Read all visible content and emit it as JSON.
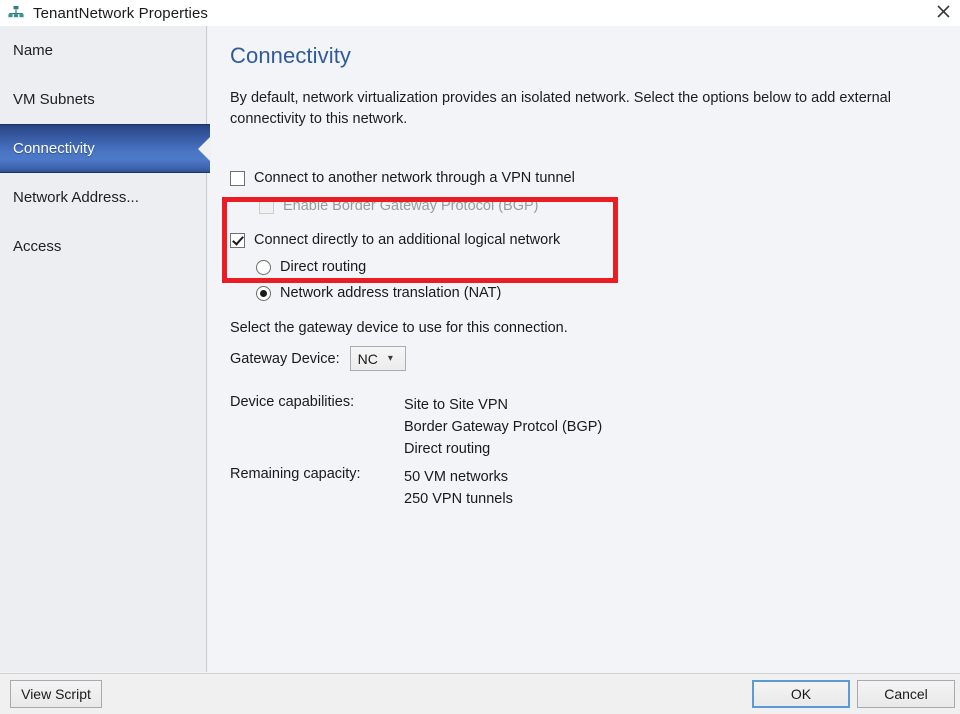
{
  "window": {
    "title": "TenantNetwork Properties",
    "title_icon": "network-properties-icon",
    "close_icon": "close-icon"
  },
  "sidebar": {
    "items": [
      {
        "label": "Name",
        "selected": false
      },
      {
        "label": "VM Subnets",
        "selected": false
      },
      {
        "label": "Connectivity",
        "selected": true
      },
      {
        "label": "Network Address...",
        "selected": false
      },
      {
        "label": "Access",
        "selected": false
      }
    ]
  },
  "content": {
    "heading": "Connectivity",
    "intro": "By default, network virtualization provides an isolated network. Select the options below to add external connectivity to this network.",
    "vpn_checkbox": {
      "label": "Connect to another network through a VPN tunnel",
      "checked": false
    },
    "bgp_checkbox": {
      "label": "Enable Border Gateway Protocol (BGP)",
      "checked": false,
      "disabled": true
    },
    "logical_network_checkbox": {
      "label": "Connect directly to an additional logical network",
      "checked": true
    },
    "routing_radios": [
      {
        "label": "Direct routing",
        "selected": false
      },
      {
        "label": "Network address translation (NAT)",
        "selected": true
      }
    ],
    "gateway_instruction": "Select the gateway device to use for this connection.",
    "gateway_device": {
      "label": "Gateway Device:",
      "value": "NC",
      "chevron_icon": "chevron-down-icon"
    },
    "device_capabilities": {
      "label": "Device capabilities:",
      "values": [
        "Site to Site VPN",
        "Border Gateway Protcol (BGP)",
        "Direct routing"
      ]
    },
    "remaining_capacity": {
      "label": "Remaining capacity:",
      "values": [
        "50 VM networks",
        "250 VPN tunnels"
      ]
    }
  },
  "footer": {
    "view_script_label": "View Script",
    "ok_label": "OK",
    "cancel_label": "Cancel"
  },
  "colors": {
    "accent_blue": "#2f5b9c",
    "selected_nav_blue": "#4a76c4",
    "annotation_red": "#ec1c24",
    "focus_border_blue": "#5b9bd5"
  }
}
